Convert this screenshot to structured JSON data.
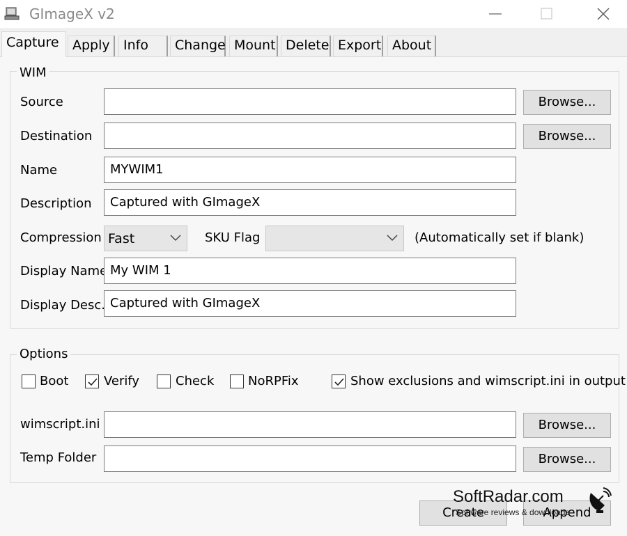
{
  "window": {
    "title": "GImageX v2"
  },
  "tabs": [
    "Capture",
    "Apply",
    "Info",
    "Change",
    "Mount",
    "Delete",
    "Export",
    "About"
  ],
  "wim": {
    "group_title": "WIM",
    "source": {
      "label": "Source",
      "value": "",
      "browse": "Browse..."
    },
    "destination": {
      "label": "Destination",
      "value": "",
      "browse": "Browse..."
    },
    "name": {
      "label": "Name",
      "value": "MYWIM1"
    },
    "description": {
      "label": "Description",
      "value": "Captured with GImageX"
    },
    "compression": {
      "label": "Compression",
      "value": "Fast"
    },
    "sku_flag": {
      "label": "SKU Flag",
      "value": "",
      "hint": "(Automatically set if blank)"
    },
    "display_name": {
      "label": "Display Name",
      "value": "My WIM 1"
    },
    "display_desc": {
      "label": "Display Desc.",
      "value": "Captured with GImageX"
    }
  },
  "options": {
    "group_title": "Options",
    "checkboxes": [
      {
        "label": "Boot",
        "checked": false
      },
      {
        "label": "Verify",
        "checked": true
      },
      {
        "label": "Check",
        "checked": false
      },
      {
        "label": "NoRPFix",
        "checked": false
      },
      {
        "label": "Show exclusions and wimscript.ini in output",
        "checked": true
      }
    ],
    "wimscript": {
      "label": "wimscript.ini",
      "value": "",
      "browse": "Browse..."
    },
    "temp_folder": {
      "label": "Temp Folder",
      "value": "",
      "browse": "Browse..."
    }
  },
  "actions": {
    "create": "Create",
    "append": "Append"
  },
  "watermark": {
    "main": "SoftRadar.com",
    "sub": "Software reviews & downloads"
  },
  "icons": [
    "app-icon",
    "minimize-icon",
    "maximize-icon",
    "close-icon",
    "chevron-down-icon",
    "checkmark-icon",
    "radar-dish-icon"
  ]
}
